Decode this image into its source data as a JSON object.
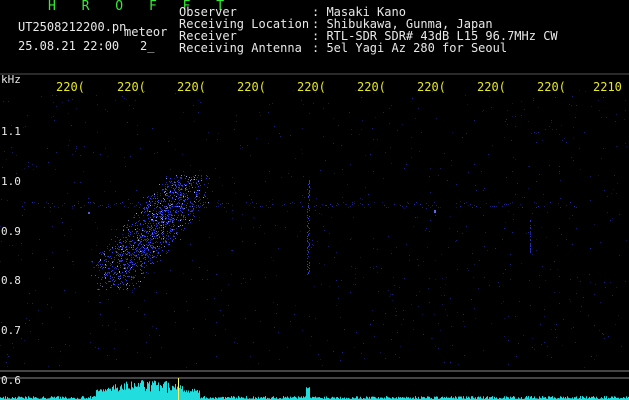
{
  "header": {
    "program": "H R O F F T",
    "filename": "UT2508212200.pn",
    "tag": "meteor",
    "datetime": "25.08.21 22:00",
    "index": "2_"
  },
  "info": {
    "labels": [
      "Observer",
      "Receiving Location",
      "Receiver",
      "Receiving Antenna"
    ],
    "values": [
      ": Masaki Kano",
      ": Shibukawa, Gunma, Japan",
      ": RTL-SDR SDR# 43dB L15 96.7MHz CW",
      ": 5el Yagi Az 280 for Seoul"
    ]
  },
  "y_axis": {
    "unit": "kHz",
    "ticks": [
      "1.1",
      "1.0",
      "0.9",
      "0.8",
      "0.7",
      "0.6"
    ]
  },
  "x_axis": {
    "ticks": [
      "220(",
      "220(",
      "220(",
      "220(",
      "220(",
      "220(",
      "220(",
      "220(",
      "220(",
      "2210"
    ]
  },
  "colors": {
    "background": "#000000",
    "echo": "#3344ff",
    "spectrum": "#22dddd",
    "axis_text": "#e8e820",
    "header_text": "#33ee33"
  }
}
